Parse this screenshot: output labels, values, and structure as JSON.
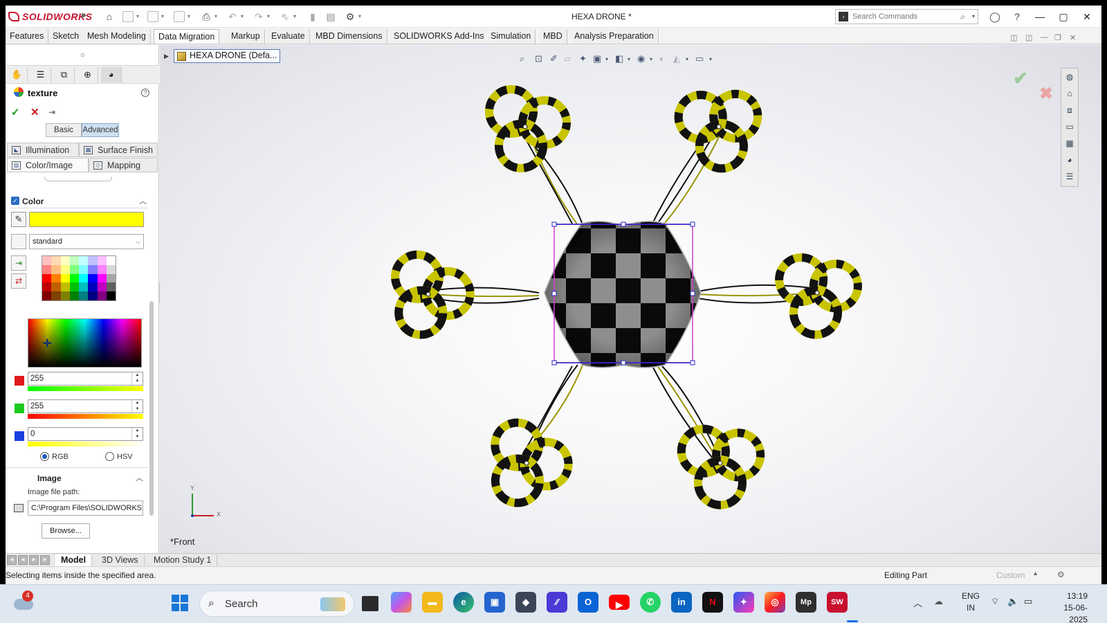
{
  "app": {
    "brand": "SOLIDWORKS",
    "document_title": "HEXA DRONE *",
    "search_placeholder": "Search Commands"
  },
  "command_tabs": [
    "Features",
    "Sketch",
    "Mesh Modeling",
    "Data Migration",
    "Markup",
    "Evaluate",
    "MBD Dimensions",
    "SOLIDWORKS Add-Ins",
    "Simulation",
    "MBD",
    "Analysis Preparation"
  ],
  "property_manager": {
    "title": "texture",
    "help": "?",
    "modes": {
      "basic": "Basic",
      "advanced": "Advanced",
      "selected": "Advanced"
    },
    "tabs": {
      "illumination": "Illumination",
      "surface_finish": "Surface Finish",
      "color_image": "Color/Image",
      "mapping": "Mapping"
    },
    "color_group": {
      "title": "Color",
      "swatch": "#ffff00",
      "palette": "standard",
      "palette_colors": [
        "#ffc0c0",
        "#ffd9b3",
        "#ffffc0",
        "#c0ffc0",
        "#c0ffff",
        "#c0c0ff",
        "#ffc0ff",
        "#ffffff",
        "#ff8080",
        "#ffbf80",
        "#ffff80",
        "#80ff80",
        "#80ffff",
        "#8080ff",
        "#ff80ff",
        "#d9d9d9",
        "#ff0000",
        "#ff8000",
        "#ffff00",
        "#00ff00",
        "#00ffff",
        "#0000ff",
        "#ff00ff",
        "#a6a6a6",
        "#c00000",
        "#c06000",
        "#c0c000",
        "#00c000",
        "#00c0c0",
        "#0000c0",
        "#c000c0",
        "#606060",
        "#800000",
        "#804000",
        "#808000",
        "#008000",
        "#008080",
        "#000080",
        "#800080",
        "#000000"
      ],
      "red": "255",
      "green": "255",
      "blue": "0",
      "mode_rgb": "RGB",
      "mode_hsv": "HSV",
      "selected_mode": "RGB"
    },
    "image_group": {
      "title": "Image",
      "path_label": "Image file path:",
      "path_value": "C:\\Program Files\\SOLIDWORKS C",
      "browse": "Browse..."
    }
  },
  "viewport": {
    "tree_item": "HEXA DRONE  (Defa...",
    "view_name": "*Front",
    "triad": {
      "x": "X",
      "y": "Y"
    },
    "colors": {
      "rotor_yellow": "#c8c400",
      "rotor_dark": "#111111",
      "check_light": "#8a8a8a",
      "selection_magenta": "#d23cd2",
      "selection_blue": "#2323c8"
    }
  },
  "bottom_tabs": [
    "Model",
    "3D Views",
    "Motion Study 1"
  ],
  "status": {
    "message": "Selecting items inside the specified area.",
    "editing": "Editing Part",
    "units": "Custom"
  },
  "taskbar": {
    "weather_badge": "4",
    "search": "Search",
    "language": "ENG",
    "region": "IN",
    "time": "13:19",
    "date": "15-06-2025"
  }
}
